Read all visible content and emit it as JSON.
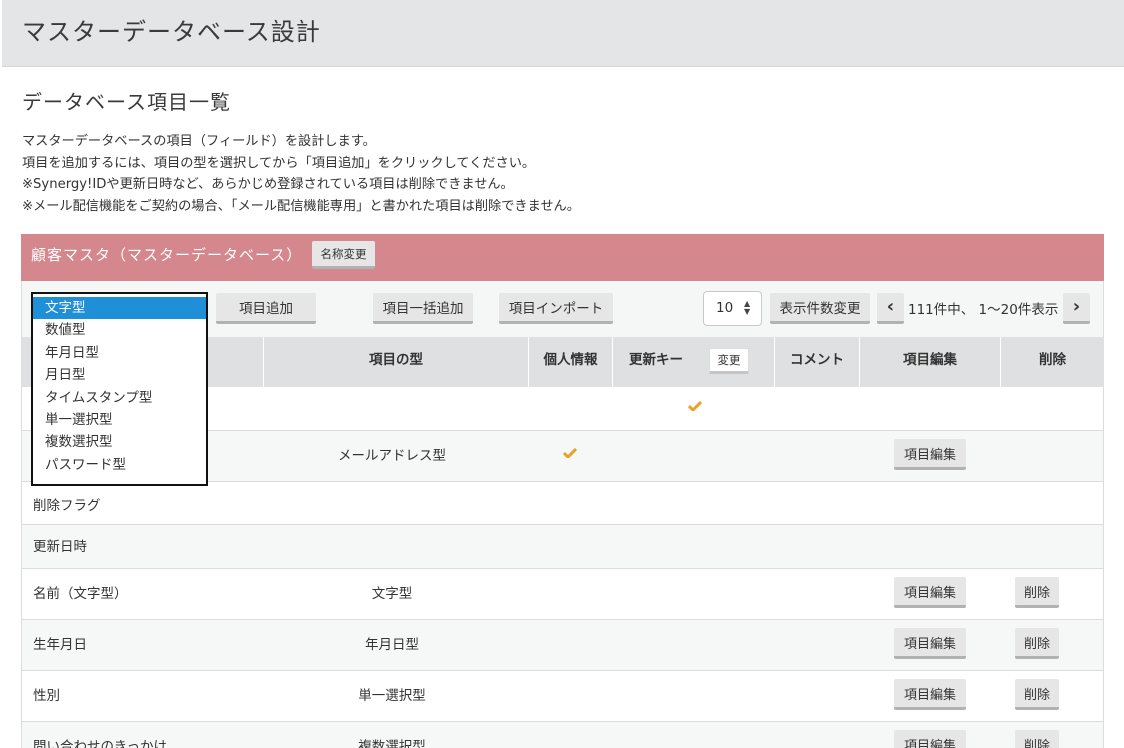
{
  "header": {
    "title": "マスターデータベース設計"
  },
  "section": {
    "title": "データベース項目一覧"
  },
  "description": [
    "マスターデータベースの項目（フィールド）を設計します。",
    "項目を追加するには、項目の型を選択してから「項目追加」をクリックしてください。",
    "※Synergy!IDや更新日時など、あらかじめ登録されている項目は削除できません。",
    "※メール配信機能をご契約の場合、「メール配信機能専用」と書かれた項目は削除できません。"
  ],
  "database": {
    "name": "顧客マスタ（マスターデータベース）",
    "rename_label": "名称変更",
    "bar_color": "#d4878c"
  },
  "toolbar": {
    "type_options": [
      "文字型",
      "数値型",
      "年月日型",
      "月日型",
      "タイムスタンプ型",
      "単一選択型",
      "複数選択型",
      "パスワード型"
    ],
    "type_selected": "文字型",
    "add_item_label": "項目追加",
    "bulk_add_label": "項目一括追加",
    "import_label": "項目インポート",
    "per_page_value": "10",
    "change_count_label": "表示件数変更",
    "prev_label": "‹",
    "next_label": "›",
    "pager_text": "111件中、 1〜20件表示"
  },
  "table": {
    "headers": {
      "type": "項目の型",
      "personal": "個人情報",
      "update_key": "更新キー",
      "change": "変更",
      "comment": "コメント",
      "edit": "項目編集",
      "delete": "削除"
    },
    "rows": [
      {
        "name": "",
        "type": "",
        "personal": false,
        "update_key": true,
        "edit": "",
        "delete": ""
      },
      {
        "name": "",
        "type": "メールアドレス型",
        "personal": true,
        "update_key": false,
        "edit": "項目編集",
        "delete": ""
      },
      {
        "name": "削除フラグ",
        "type": "",
        "personal": false,
        "update_key": false,
        "edit": "",
        "delete": ""
      },
      {
        "name": "更新日時",
        "type": "",
        "personal": false,
        "update_key": false,
        "edit": "",
        "delete": ""
      },
      {
        "name": "名前（文字型）",
        "type": "文字型",
        "personal": false,
        "update_key": false,
        "edit": "項目編集",
        "delete": "削除"
      },
      {
        "name": "生年月日",
        "type": "年月日型",
        "personal": false,
        "update_key": false,
        "edit": "項目編集",
        "delete": "削除"
      },
      {
        "name": "性別",
        "type": "単一選択型",
        "personal": false,
        "update_key": false,
        "edit": "項目編集",
        "delete": "削除"
      },
      {
        "name": "問い合わせのきっかけ",
        "type": "複数選択型",
        "personal": false,
        "update_key": false,
        "edit": "項目編集",
        "delete": "削除"
      }
    ]
  },
  "colors": {
    "check": "#e9a323",
    "selected_option": "#1f8fd8",
    "header_bg": "#e3e5e6"
  }
}
